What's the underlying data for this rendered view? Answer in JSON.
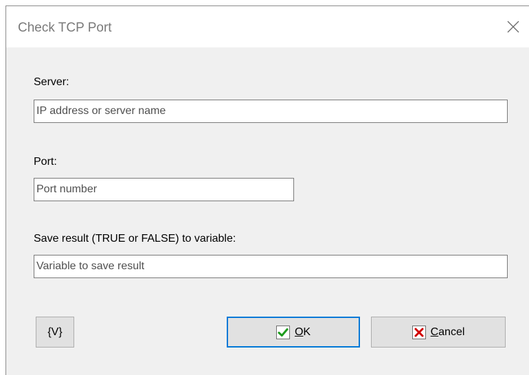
{
  "dialog": {
    "title": "Check TCP Port",
    "close_icon": "close-icon"
  },
  "server": {
    "label": "Server:",
    "placeholder": "IP address or server name",
    "value": ""
  },
  "port": {
    "label": "Port:",
    "placeholder": "Port number",
    "value": ""
  },
  "result": {
    "label": "Save result (TRUE or FALSE) to variable:",
    "placeholder": "Variable to save result",
    "value": ""
  },
  "buttons": {
    "variables_label": "{V}",
    "ok_mnemonic": "O",
    "ok_rest": "K",
    "ok_icon": "checkmark-icon",
    "cancel_mnemonic": "C",
    "cancel_rest": "ancel",
    "cancel_icon": "x-icon"
  },
  "colors": {
    "window_bg": "#f0f0f0",
    "default_button_border": "#0078d7",
    "ok_check": "#1e9c1e",
    "cancel_x": "#d00000"
  }
}
